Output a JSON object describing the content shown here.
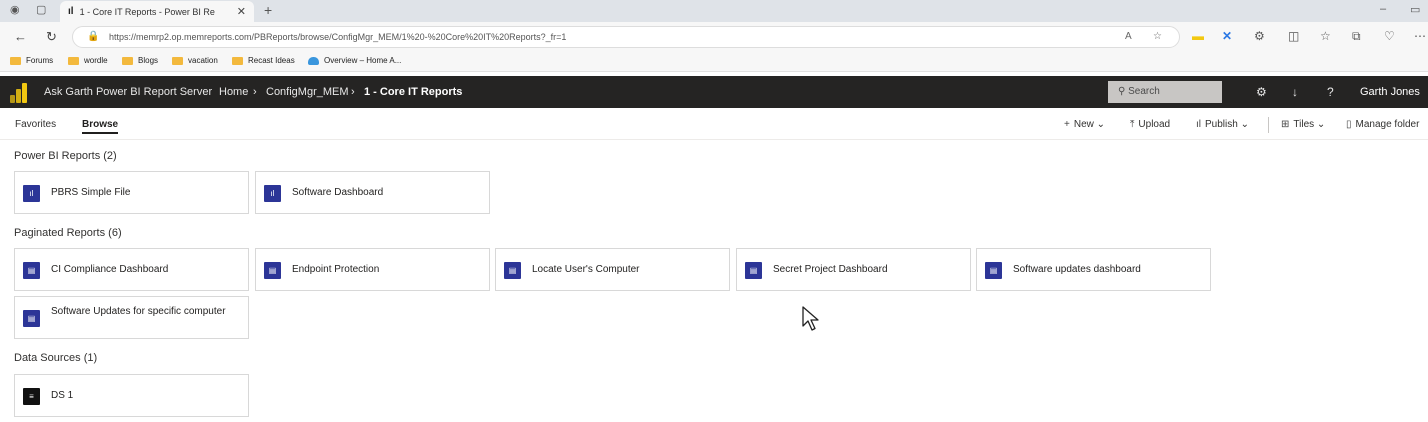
{
  "browser": {
    "tab_title": "1 - Core IT Reports - Power BI Re",
    "url": "https://memrp2.op.memreports.com/PBReports/browse/ConfigMgr_MEM/1%20-%20Core%20IT%20Reports?_fr=1",
    "bookmarks": [
      "Forums",
      "wordle",
      "Blogs",
      "vacation",
      "Recast Ideas",
      "Overview – Home A..."
    ]
  },
  "app": {
    "title": "Ask Garth Power BI Report Server",
    "breadcrumbs": [
      "Home",
      "ConfigMgr_MEM",
      "1 - Core IT Reports"
    ],
    "search_placeholder": "Search",
    "user": "Garth Jones"
  },
  "toolbar": {
    "tabs": [
      "Favorites",
      "Browse"
    ],
    "active_tab": "Browse",
    "actions": [
      "New",
      "Upload",
      "Publish",
      "Tiles",
      "Manage folder"
    ]
  },
  "sections": [
    {
      "title": "Power BI Reports (2)",
      "items": [
        "PBRS Simple File",
        "Software Dashboard"
      ]
    },
    {
      "title": "Paginated Reports (6)",
      "items": [
        "CI Compliance Dashboard",
        "Endpoint Protection",
        "Locate User's Computer",
        "Secret Project Dashboard",
        "Software updates dashboard",
        "Software Updates for specific computer"
      ]
    },
    {
      "title": "Data Sources (1)",
      "items": [
        "DS 1"
      ]
    }
  ],
  "colors": {
    "appbar": "#252423",
    "report_icon": "#2c3597",
    "datasource_icon": "#111111",
    "logo": "#f2c811"
  },
  "icons": [
    "power-bi-report-icon",
    "paginated-report-icon",
    "data-source-icon"
  ]
}
